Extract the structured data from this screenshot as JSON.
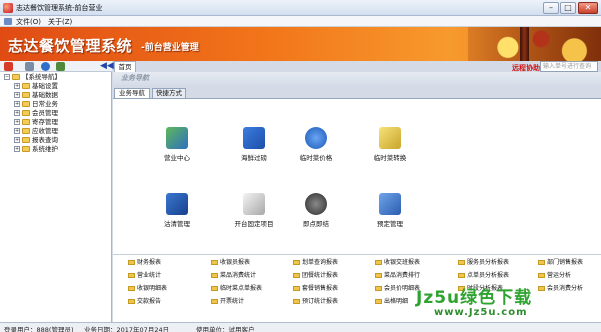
{
  "window": {
    "title": "志达餐饮管理系统-前台营业",
    "minimize": "–",
    "maximize": "□",
    "close": "✕"
  },
  "menu": {
    "items": [
      "文件(O)",
      "关于(Z)"
    ]
  },
  "banner": {
    "title": "志达餐饮管理系统",
    "subtitle": "-前台营业管理",
    "remote": "远程协助",
    "search_placeholder": "输入单号进行查询"
  },
  "tab": {
    "home": "首页"
  },
  "nav": {
    "title": "业务导航",
    "tabs": [
      "业务导航",
      "快捷方式"
    ]
  },
  "tree": {
    "root": "【系统导航】",
    "items": [
      "基础设置",
      "基础数据",
      "日常业务",
      "会员管理",
      "寄存管理",
      "应收管理",
      "报表查询",
      "系统维护"
    ]
  },
  "functions": [
    {
      "label": "营业中心",
      "icon": "pos-terminal-icon"
    },
    {
      "label": "海鲜过磅",
      "icon": "scale-icon"
    },
    {
      "label": "临时菜价格",
      "icon": "info-icon"
    },
    {
      "label": "临时菜转换",
      "icon": "convert-icon"
    },
    {
      "label": "沽清管理",
      "icon": "sold-out-icon"
    },
    {
      "label": "开台固定项目",
      "icon": "register-icon"
    },
    {
      "label": "即点即结",
      "icon": "instant-pay-icon"
    },
    {
      "label": "预定管理",
      "icon": "reservation-icon"
    }
  ],
  "reports": [
    [
      "财务报表",
      "收银员报表",
      "划单查询报表",
      "收银交班报表",
      "服务员分析报表",
      "部门销售报表"
    ],
    [
      "营业统计",
      "菜品消费统计",
      "团餐统计报表",
      "菜品消费排行",
      "点单员分析报表",
      "营运分析"
    ],
    [
      "收银明细表",
      "临时菜点单报表",
      "套餐销售报表",
      "会员价明细表",
      "时段分析报表",
      "会员消费分析"
    ],
    [
      "交款报告",
      "开票统计",
      "预订统计报表",
      "出格明细",
      "",
      ""
    ]
  ],
  "status": {
    "user": "登录用户：888(管理员)",
    "date": "业务日期：2017年07月24日",
    "unit": "使用单位：试用客户"
  },
  "watermark": {
    "main": "Jz5u绿色下载",
    "sub": "www.Jz5u.com"
  }
}
